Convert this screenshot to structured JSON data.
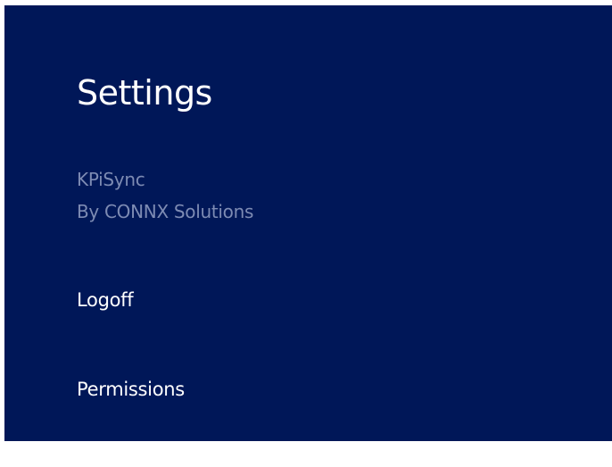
{
  "panel": {
    "title": "Settings",
    "app_name": "KPiSync",
    "publisher": "By CONNX Solutions",
    "items": [
      {
        "label": "Logoff"
      },
      {
        "label": "Permissions"
      }
    ],
    "colors": {
      "background": "#001758",
      "title_text": "#ffffff",
      "secondary_text": "#7d8bb3"
    }
  }
}
